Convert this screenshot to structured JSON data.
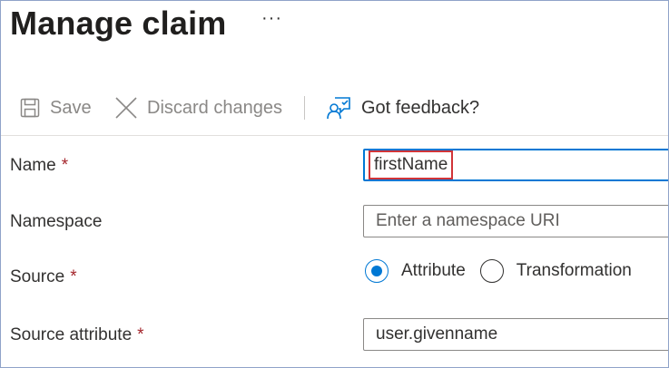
{
  "header": {
    "title": "Manage claim",
    "more_label": "···"
  },
  "toolbar": {
    "save_label": "Save",
    "discard_label": "Discard changes",
    "feedback_label": "Got feedback?"
  },
  "form": {
    "name": {
      "label": "Name",
      "required": "*",
      "value": "firstName"
    },
    "namespace": {
      "label": "Namespace",
      "placeholder": "Enter a namespace URI"
    },
    "source": {
      "label": "Source",
      "required": "*",
      "options": [
        "Attribute",
        "Transformation"
      ],
      "selected": "Attribute"
    },
    "source_attribute": {
      "label": "Source attribute",
      "required": "*",
      "value": "user.givenname"
    }
  },
  "colors": {
    "accent": "#0078d4",
    "required": "#a4262c",
    "highlight": "#d13438"
  }
}
